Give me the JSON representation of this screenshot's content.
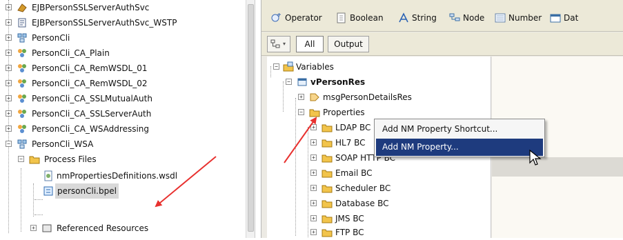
{
  "project_tree": {
    "items": [
      {
        "label": "EJBPersonSSLServerAuthSvc",
        "icon": "ejb-icon"
      },
      {
        "label": "EJBPersonSSLServerAuthSvc_WSTP",
        "icon": "document-icon"
      },
      {
        "label": "PersonCli",
        "icon": "composite-app-icon"
      },
      {
        "label": "PersonCli_CA_Plain",
        "icon": "casa-app-icon"
      },
      {
        "label": "PersonCli_CA_RemWSDL_01",
        "icon": "casa-app-icon"
      },
      {
        "label": "PersonCli_CA_RemWSDL_02",
        "icon": "casa-app-icon"
      },
      {
        "label": "PersonCli_CA_SSLMutualAuth",
        "icon": "casa-app-icon"
      },
      {
        "label": "PersonCli_CA_SSLServerAuth",
        "icon": "casa-app-icon"
      },
      {
        "label": "PersonCli_CA_WSAddressing",
        "icon": "casa-app-icon"
      },
      {
        "label": "PersonCli_WSA",
        "icon": "composite-app-icon"
      },
      {
        "label": "Process Files",
        "icon": "folder-icon"
      },
      {
        "label": "nmPropertiesDefinitions.wsdl",
        "icon": "wsdl-file-icon"
      },
      {
        "label": "personCli.bpel",
        "icon": "bpel-file-icon"
      },
      {
        "label": "Referenced Resources",
        "icon": "resources-folder-icon"
      }
    ]
  },
  "palette": {
    "items": [
      {
        "label": "Operator",
        "icon": "operator-icon"
      },
      {
        "label": "Boolean",
        "icon": "boolean-icon"
      },
      {
        "label": "String",
        "icon": "string-icon"
      },
      {
        "label": "Node",
        "icon": "node-icon"
      },
      {
        "label": "Number",
        "icon": "number-icon"
      },
      {
        "label": "Dat",
        "icon": "date-icon"
      }
    ]
  },
  "view_bar": {
    "all_label": "All",
    "output_label": "Output"
  },
  "variables_tree": {
    "items": [
      {
        "label": "Variables"
      },
      {
        "label": "vPersonRes"
      },
      {
        "label": "msgPersonDetailsRes"
      },
      {
        "label": "Properties"
      },
      {
        "label": "LDAP BC"
      },
      {
        "label": "HL7 BC"
      },
      {
        "label": "SOAP HTTP BC"
      },
      {
        "label": "Email BC"
      },
      {
        "label": "Scheduler BC"
      },
      {
        "label": "Database BC"
      },
      {
        "label": "JMS BC"
      },
      {
        "label": "FTP BC"
      }
    ]
  },
  "context_menu": {
    "items": [
      {
        "label": "Add NM Property Shortcut..."
      },
      {
        "label": "Add NM Property..."
      }
    ]
  },
  "colors": {
    "menu_highlight": "#1e3b7e",
    "annotation_arrow": "#e8312f",
    "folder": "#f2c44b"
  }
}
